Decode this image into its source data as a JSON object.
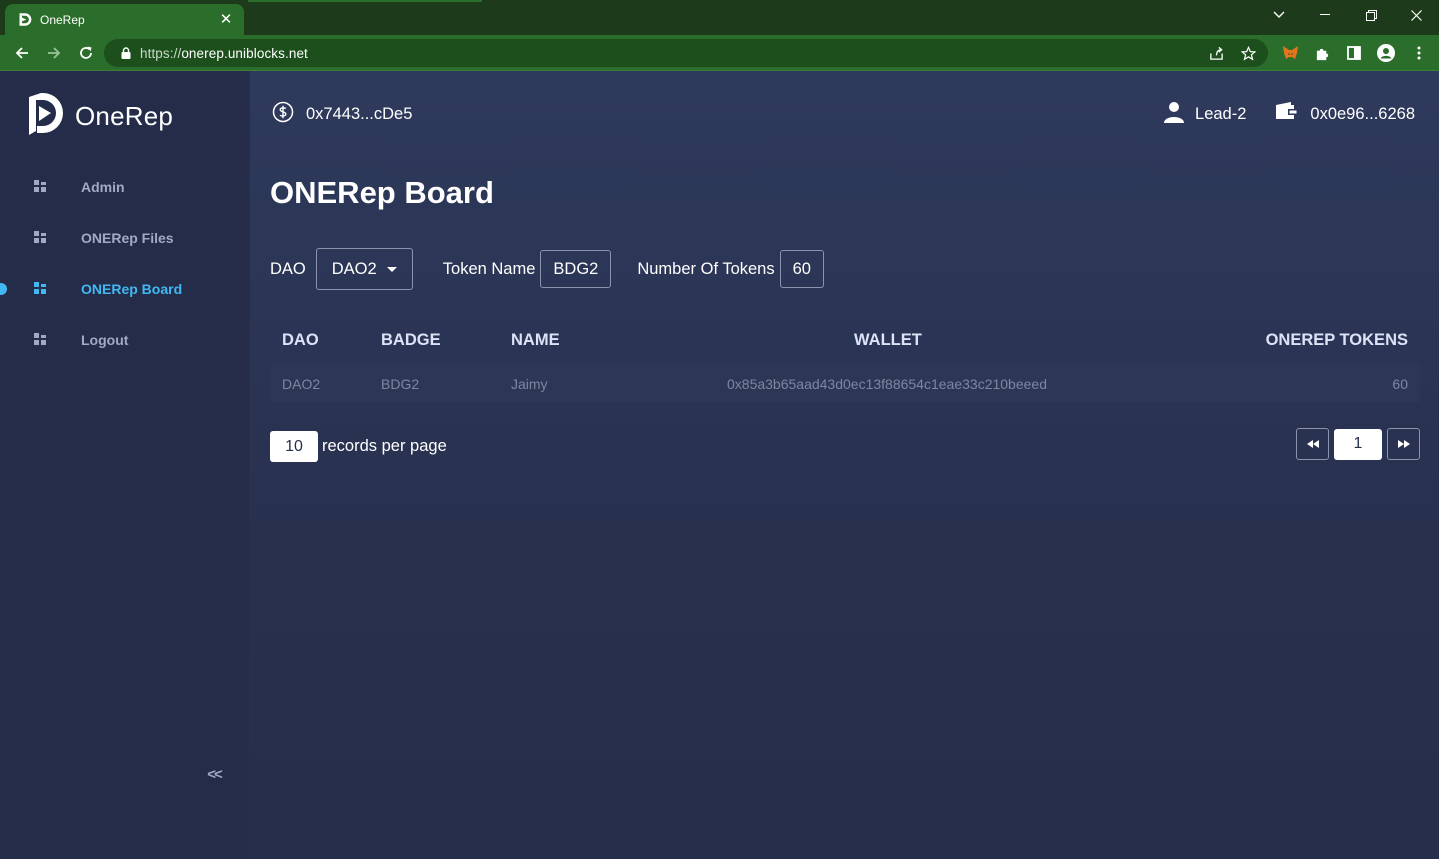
{
  "browser": {
    "tab_title": "OneRep",
    "url_scheme": "https://",
    "url_host": "onerep.uniblocks.net"
  },
  "brand": {
    "name": "OneRep"
  },
  "sidebar": {
    "items": [
      {
        "label": "Admin",
        "active": false
      },
      {
        "label": "ONERep Files",
        "active": false
      },
      {
        "label": "ONERep Board",
        "active": true
      },
      {
        "label": "Logout",
        "active": false
      }
    ],
    "collapse_label": "<<"
  },
  "header": {
    "contract_address": "0x7443...cDe5",
    "role": "Lead-2",
    "wallet_address": "0x0e96...6268"
  },
  "page": {
    "title": "ONERep Board"
  },
  "filters": {
    "dao_label": "DAO",
    "dao_value": "DAO2",
    "token_name_label": "Token Name",
    "token_name_value": "BDG2",
    "num_tokens_label": "Number Of Tokens",
    "num_tokens_value": "60"
  },
  "table": {
    "headers": [
      "DAO",
      "BADGE",
      "NAME",
      "WALLET",
      "ONEREP TOKENS"
    ],
    "rows": [
      [
        "DAO2",
        "BDG2",
        "Jaimy",
        "0x85a3b65aad43d0ec13f88654c1eae33c210beeed",
        "60"
      ]
    ]
  },
  "pagination": {
    "records_per_page": "10",
    "records_per_page_label": "records per page",
    "current_page": "1"
  },
  "colors": {
    "accent": "#41b8f2",
    "sidebar_bg": "#252c49",
    "main_bg": "#28304e",
    "browser_green": "#2b6e2b"
  }
}
